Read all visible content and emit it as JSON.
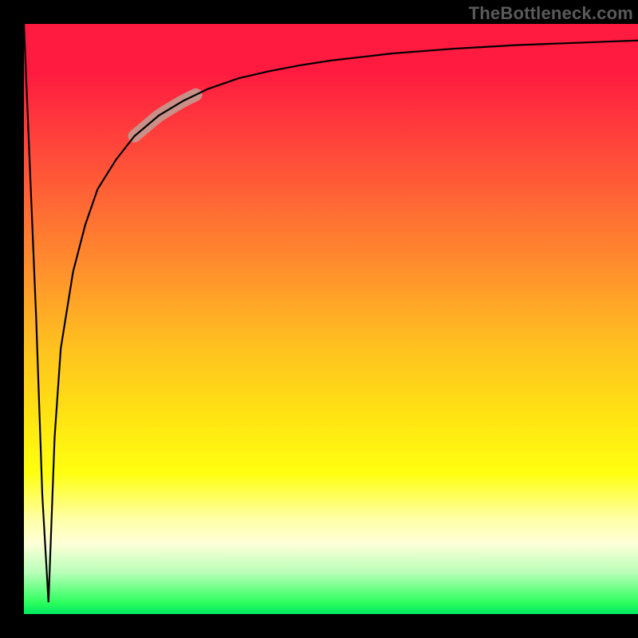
{
  "attribution": "TheBottleneck.com",
  "chart_data": {
    "type": "line",
    "title": "",
    "xlabel": "",
    "ylabel": "",
    "xlim": [
      0,
      100
    ],
    "ylim": [
      0,
      100
    ],
    "grid": false,
    "annotations": [
      {
        "kind": "highlight-segment",
        "x_range": [
          18,
          28
        ],
        "color": "#c99088"
      }
    ],
    "series": [
      {
        "name": "bottleneck-curve",
        "color": "#000000",
        "x": [
          0,
          2,
          3,
          4,
          5,
          6,
          8,
          10,
          12,
          15,
          18,
          22,
          26,
          30,
          35,
          40,
          45,
          50,
          55,
          60,
          65,
          70,
          75,
          80,
          85,
          90,
          95,
          100
        ],
        "y": [
          100,
          50,
          20,
          2,
          30,
          45,
          58,
          66,
          72,
          77,
          81,
          84.5,
          87,
          89,
          90.8,
          92,
          93,
          93.8,
          94.4,
          95,
          95.4,
          95.8,
          96.1,
          96.4,
          96.6,
          96.8,
          97,
          97.2
        ]
      }
    ]
  }
}
